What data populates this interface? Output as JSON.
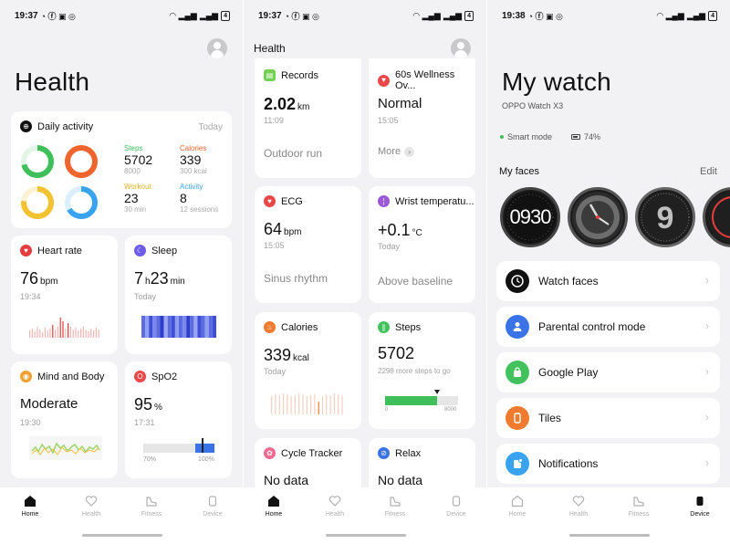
{
  "screens": [
    {
      "status": {
        "time": "19:37",
        "battery": "4"
      },
      "title": "Health",
      "daily": {
        "title": "Daily activity",
        "today": "Today",
        "steps": {
          "label": "Steps",
          "value": "5702",
          "goal": "8000"
        },
        "calories": {
          "label": "Calories",
          "value": "339",
          "goal": "300 kcal"
        },
        "workout": {
          "label": "Workout",
          "value": "23",
          "goal": "30 min"
        },
        "activity": {
          "label": "Activity",
          "value": "8",
          "goal": "12 sessions"
        }
      },
      "heart": {
        "title": "Heart rate",
        "value": "76",
        "unit": "bpm",
        "time": "19:34"
      },
      "sleep": {
        "title": "Sleep",
        "h": "7",
        "hu": "h",
        "m": "23",
        "mu": "min",
        "sub": "Today"
      },
      "mind": {
        "title": "Mind and Body",
        "value": "Moderate",
        "time": "19:30"
      },
      "spo2": {
        "title": "SpO2",
        "value": "95",
        "unit": "%",
        "time": "17:31",
        "min_label": "70%",
        "max_label": "100%",
        "level": 95
      }
    },
    {
      "status": {
        "time": "19:37",
        "battery": "4"
      },
      "title": "Health",
      "records": {
        "title": "Records",
        "value": "2.02",
        "unit": "km",
        "time": "11:09",
        "foot": "Outdoor run"
      },
      "wellness": {
        "title": "60s Wellness Ov...",
        "value": "Normal",
        "time": "15:05",
        "more": "More"
      },
      "ecg": {
        "title": "ECG",
        "value": "64",
        "unit": "bpm",
        "time": "15:05",
        "foot": "Sinus rhythm"
      },
      "wrist": {
        "title": "Wrist temperatu...",
        "value": "+0.1",
        "unit": "°C",
        "sub": "Today",
        "foot": "Above baseline"
      },
      "calories": {
        "title": "Calories",
        "value": "339",
        "unit": "kcal",
        "sub": "Today"
      },
      "steps": {
        "title": "Steps",
        "value": "5702",
        "sub": "2298 more steps to go",
        "min_label": "0",
        "max_label": "8000",
        "progress": 0.713
      },
      "cycle": {
        "title": "Cycle Tracker",
        "value": "No data"
      },
      "relax": {
        "title": "Relax",
        "value": "No data"
      }
    },
    {
      "status": {
        "time": "19:38",
        "battery": "4"
      },
      "title": "My watch",
      "model": "OPPO Watch X3",
      "mode": "Smart mode",
      "battery_pct": "74%",
      "faces": {
        "title": "My faces",
        "edit": "Edit",
        "face1_text": "0930"
      },
      "items": [
        "Watch faces",
        "Parental control mode",
        "Google Play",
        "Tiles",
        "Notifications"
      ]
    }
  ],
  "tabs": [
    "Home",
    "Health",
    "Fitness",
    "Device"
  ],
  "colors": {
    "steps": "#3fbf5a",
    "calories": "#f0642d",
    "workout": "#f2c230",
    "activity": "#3aa3f0",
    "heart": "#e43d3d",
    "sleep": "#6c5ce7",
    "mind": "#f0a030",
    "spo2": "#e84848",
    "records": "#74cf55",
    "wellness": "#e84848",
    "ecg": "#e84848",
    "wrist": "#9b59d6",
    "cal_icon": "#f07a2d",
    "steps_icon": "#41c25c",
    "cycle": "#f06a90",
    "relax": "#3a73e8"
  }
}
